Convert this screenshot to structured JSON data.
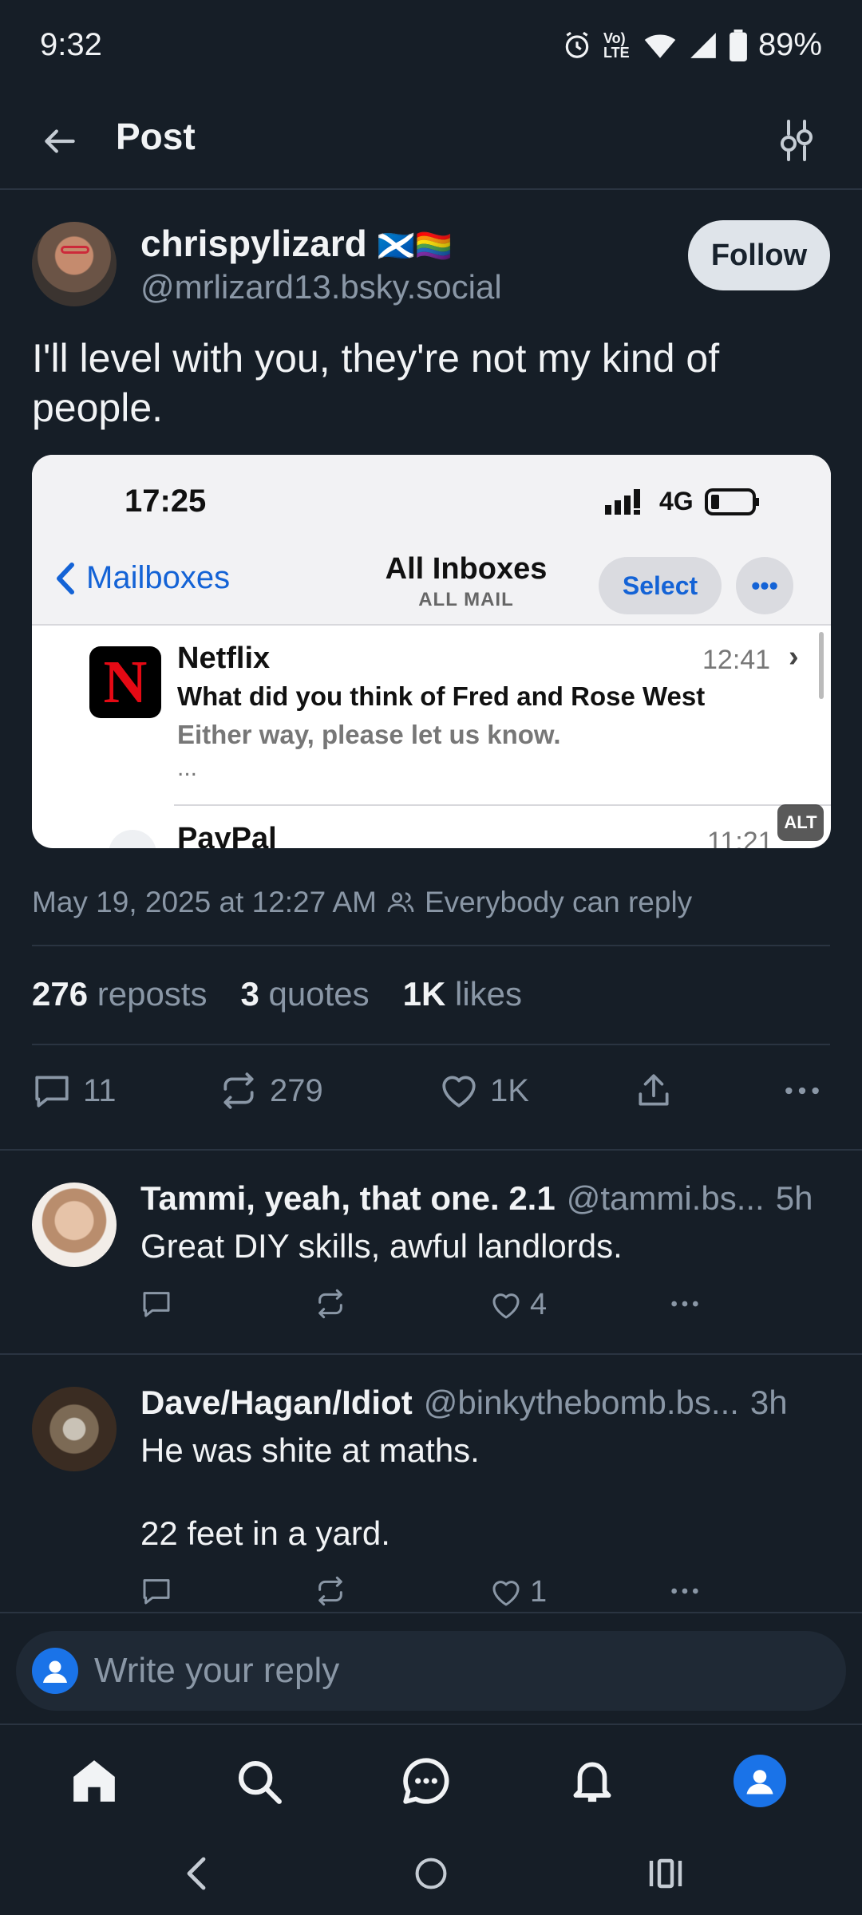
{
  "status_bar": {
    "time": "9:32",
    "volte": "Vo) LTE",
    "battery": "89%"
  },
  "header": {
    "title": "Post"
  },
  "post": {
    "author_name": "chrispylizard",
    "author_flags": "🏴󠁧󠁢󠁳󠁣󠁴󠁿🏳️‍🌈",
    "author_handle": "@mrlizard13.bsky.social",
    "follow_label": "Follow",
    "text": "I'll level with you, they're not my kind of people.",
    "embed": {
      "time": "17:25",
      "network": "4G",
      "back_label": "Mailboxes",
      "title": "All Inboxes",
      "subtitle": "ALL MAIL",
      "select_label": "Select",
      "more_label": "•••",
      "email1": {
        "logo": "N",
        "sender": "Netflix",
        "time": "12:41",
        "subject": "What did you think of Fred and Rose West",
        "preview": "Either way, please let us know.",
        "ellipsis": "..."
      },
      "email2": {
        "sender": "PayPal",
        "time": "11:21"
      },
      "alt_badge": "ALT"
    },
    "timestamp": "May 19, 2025 at 12:27 AM",
    "reply_setting": "Everybody can reply",
    "stats": {
      "reposts_count": "276",
      "reposts_label": "reposts",
      "quotes_count": "3",
      "quotes_label": "quotes",
      "likes_count": "1K",
      "likes_label": "likes"
    },
    "actions": {
      "replies": "11",
      "reposts": "279",
      "likes": "1K"
    }
  },
  "replies": [
    {
      "name": "Tammi, yeah, that one. 2.1",
      "handle": "@tammi.bs...",
      "age": "5h",
      "text": "Great DIY skills, awful landlords.",
      "likes": "4"
    },
    {
      "name": "Dave/Hagan/Idiot",
      "handle": "@binkythebomb.bs...",
      "age": "3h",
      "text_line1": "He was shite at maths.",
      "text_line2": "22 feet in a yard.",
      "likes": "1"
    }
  ],
  "composer": {
    "placeholder": "Write your reply"
  },
  "colors": {
    "background": "#161e27",
    "accent": "#1a73e8",
    "muted": "#8a97a6"
  }
}
